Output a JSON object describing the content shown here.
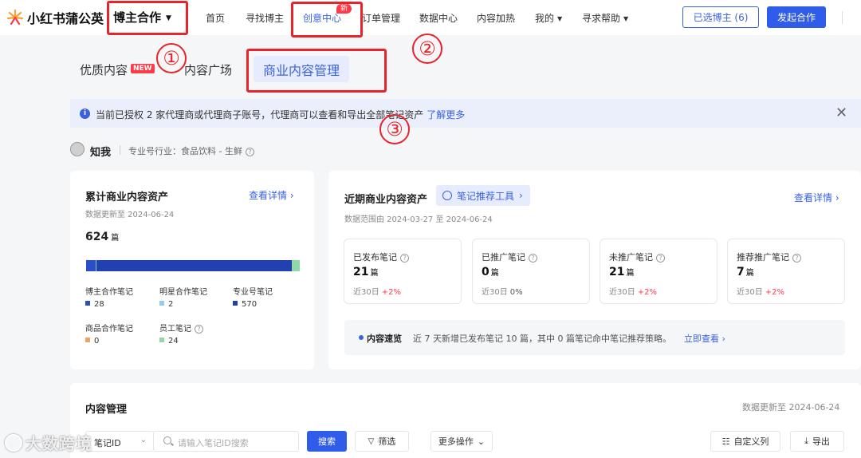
{
  "topbar": {
    "logo_text": "小红书蒲公英",
    "brand_menu": "博主合作",
    "nav": [
      {
        "label": "首页"
      },
      {
        "label": "寻找博主"
      },
      {
        "label": "创意中心",
        "badge": "新"
      },
      {
        "label": "订单管理"
      },
      {
        "label": "数据中心"
      },
      {
        "label": "内容加热"
      },
      {
        "label": "我的"
      },
      {
        "label": "寻求帮助"
      }
    ],
    "selected_button": "已选博主 (6)",
    "launch_button": "发起合作"
  },
  "annotations": [
    "①",
    "②",
    "③"
  ],
  "subtabs": {
    "quality": "优质内容",
    "new_badge": "NEW",
    "square": "内容广场",
    "active": "商业内容管理"
  },
  "banner": {
    "text": "当前已授权 2 家代理商或代理商子账号，代理商可以查看和导出全部笔记资产",
    "link": "了解更多"
  },
  "account": {
    "name": "知我",
    "industry": "专业号行业：食品饮料 - 生鲜"
  },
  "cumulative": {
    "title": "累计商业内容资产",
    "link": "查看详情",
    "updated": "数据更新至 2024-06-24",
    "total": "624",
    "total_unit": "篇",
    "items": [
      {
        "label": "博主合作笔记",
        "value": "28",
        "color": "#2b4ec8"
      },
      {
        "label": "明星合作笔记",
        "value": "2",
        "color": "#8fd0e8"
      },
      {
        "label": "专业号笔记",
        "value": "570",
        "color": "#2340b0"
      },
      {
        "label": "商品合作笔记",
        "value": "0",
        "color": "#f0a35e"
      },
      {
        "label": "员工笔记",
        "value": "24",
        "color": "#8fd9a8"
      }
    ]
  },
  "recent": {
    "title": "近期商业内容资产",
    "tool": "笔记推荐工具",
    "link": "查看详情",
    "range": "数据范围由 2024-03-27 至 2024-06-24",
    "stats": [
      {
        "label": "已发布笔记",
        "value": "21",
        "unit": "篇",
        "trend_label": "近30日",
        "trend": "+2%"
      },
      {
        "label": "已推广笔记",
        "value": "0",
        "unit": "篇",
        "trend_label": "近30日",
        "trend": "0%"
      },
      {
        "label": "未推广笔记",
        "value": "21",
        "unit": "篇",
        "trend_label": "近30日",
        "trend": "+2%"
      },
      {
        "label": "推荐推广笔记",
        "value": "7",
        "unit": "篇",
        "trend_label": "近30日",
        "trend": "+2%"
      }
    ],
    "overview": {
      "title": "内容速览",
      "text": "近 7 天新增已发布笔记 10 篇，其中 0 篇笔记命中笔记推荐策略。",
      "link": "立即查看"
    }
  },
  "management": {
    "title": "内容管理",
    "updated": "数据更新至 2024-06-24",
    "filter_select": "笔记ID",
    "search_placeholder": "请输入笔记ID搜索",
    "search_button": "搜索",
    "filter_button": "筛选",
    "more_button": "更多操作",
    "columns_button": "自定义列",
    "export_button": "导出"
  },
  "watermark": "大数跨境"
}
